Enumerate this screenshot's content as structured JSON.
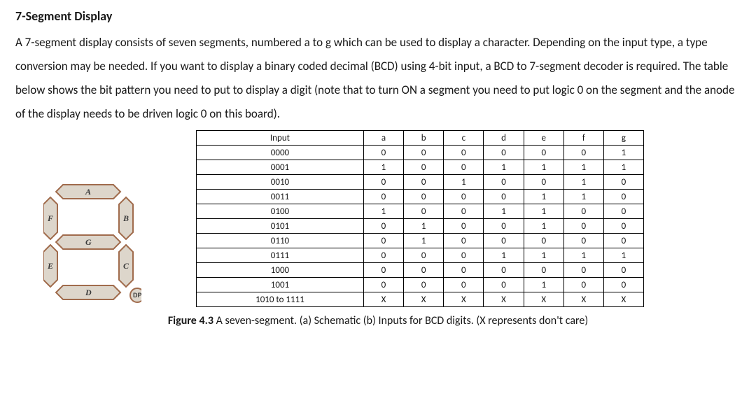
{
  "heading": "7-Segment Display",
  "paragraph": "A 7-segment display consists of seven segments, numbered a to g which can be used to display a character. Depending on the input type, a type conversion may be needed. If you want to display a binary coded decimal (BCD) using 4-bit input, a BCD to 7-segment decoder is required. The table below shows the bit pattern you need to put to display a digit (note that to turn ON a segment you need to put logic 0 on the segment and the anode of the display needs to be driven logic 0 on this board).",
  "schematic_labels": {
    "A": "A",
    "B": "B",
    "C": "C",
    "D": "D",
    "E": "E",
    "F": "F",
    "G": "G",
    "DP": "DP"
  },
  "table": {
    "headers": [
      "Input",
      "a",
      "b",
      "c",
      "d",
      "e",
      "f",
      "g"
    ],
    "rows": [
      [
        "0000",
        "0",
        "0",
        "0",
        "0",
        "0",
        "0",
        "1"
      ],
      [
        "0001",
        "1",
        "0",
        "0",
        "1",
        "1",
        "1",
        "1"
      ],
      [
        "0010",
        "0",
        "0",
        "1",
        "0",
        "0",
        "1",
        "0"
      ],
      [
        "0011",
        "0",
        "0",
        "0",
        "0",
        "1",
        "1",
        "0"
      ],
      [
        "0100",
        "1",
        "0",
        "0",
        "1",
        "1",
        "0",
        "0"
      ],
      [
        "0101",
        "0",
        "1",
        "0",
        "0",
        "1",
        "0",
        "0"
      ],
      [
        "0110",
        "0",
        "1",
        "0",
        "0",
        "0",
        "0",
        "0"
      ],
      [
        "0111",
        "0",
        "0",
        "0",
        "1",
        "1",
        "1",
        "1"
      ],
      [
        "1000",
        "0",
        "0",
        "0",
        "0",
        "0",
        "0",
        "0"
      ],
      [
        "1001",
        "0",
        "0",
        "0",
        "0",
        "1",
        "0",
        "0"
      ],
      [
        "1010 to 1111",
        "X",
        "X",
        "X",
        "X",
        "X",
        "X",
        "X"
      ]
    ]
  },
  "caption_bold": "Figure 4.3",
  "caption_rest": " A seven-segment. (a) Schematic (b) Inputs for BCD digits. (X represents don't care)"
}
